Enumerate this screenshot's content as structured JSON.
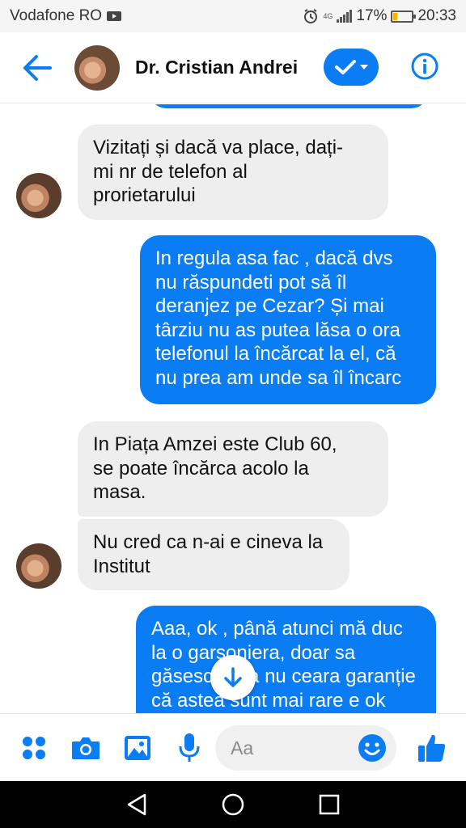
{
  "status_bar": {
    "carrier": "Vodafone RO",
    "network": "4G",
    "battery": "17%",
    "time": "20:33"
  },
  "header": {
    "contact_name": "Dr. Cristian Andrei",
    "icons": {
      "back": "back-arrow-icon",
      "verify": "check-icon",
      "info": "info-icon"
    }
  },
  "messages": [
    {
      "direction": "incoming",
      "text": "Vizitați și dacă va place, dați-\nmi nr de telefon al\nprorietarului"
    },
    {
      "direction": "outgoing",
      "text": "In regula asa fac , dacă dvs\nnu răspundeti pot să îl\nderanjez pe Cezar? Și mai\ntârziu nu as putea lăsa o ora\ntelefonul la încărcat la el, că\nnu prea am unde sa îl încarc"
    },
    {
      "direction": "incoming",
      "text": "In Piața Amzei este Club 60,\nse poate încărca acolo la\nmasa."
    },
    {
      "direction": "incoming",
      "text": "Nu cred ca n-ai e cineva la\nInstitut"
    },
    {
      "direction": "outgoing",
      "text": "Aaa, ok , până atunci mă duc\nla o garsoniera, doar sa\ngăsesc ceva nu ceara garanție\ncă astea sunt mai rare e ok"
    }
  ],
  "composer": {
    "placeholder": "Aa",
    "icons": [
      "menu-dots-icon",
      "camera-icon",
      "gallery-icon",
      "microphone-icon",
      "emoji-icon",
      "thumbs-up-icon"
    ]
  },
  "colors": {
    "accent": "#0a7cf4",
    "incoming_bubble": "#eeeeee",
    "outgoing_bubble": "#0a7cf4"
  }
}
